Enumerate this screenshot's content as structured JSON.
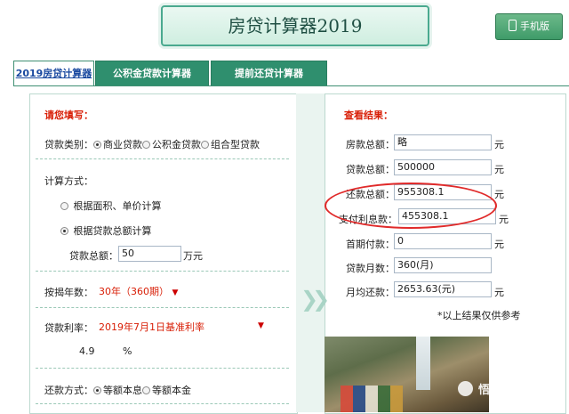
{
  "header": {
    "title": "房贷计算器2019",
    "mobile_button": "手机版"
  },
  "tabs": [
    {
      "label": "2019房贷计算器",
      "active": true
    },
    {
      "label": "公积金贷款计算器",
      "active": false
    },
    {
      "label": "提前还贷计算器",
      "active": false
    }
  ],
  "form": {
    "heading": "请您填写：",
    "loan_type": {
      "label": "贷款类别：",
      "options": [
        "商业贷款",
        "公积金贷款",
        "组合型贷款"
      ],
      "selected": "商业贷款"
    },
    "calc_method": {
      "label": "计算方式：",
      "options": [
        "根据面积、单价计算",
        "根据贷款总额计算"
      ],
      "selected": "根据贷款总额计算"
    },
    "loan_total": {
      "label": "贷款总额：",
      "value": "50",
      "unit": "万元"
    },
    "years": {
      "label": "按揭年数：",
      "value": "30年（360期）"
    },
    "rate": {
      "label": "贷款利率：",
      "value": "2019年7月1日基准利率",
      "number": "4.9",
      "unit": "%"
    },
    "repay": {
      "label": "还款方式：",
      "options": [
        "等额本息",
        "等额本金"
      ],
      "selected": "等额本息"
    }
  },
  "results": {
    "heading": "查看结果：",
    "rows": [
      {
        "label": "房款总额：",
        "value": "略",
        "unit": "元"
      },
      {
        "label": "贷款总额：",
        "value": "500000",
        "unit": "元"
      },
      {
        "label": "还款总额：",
        "value": "955308.1",
        "unit": "元"
      },
      {
        "label": "支付利息款：",
        "value": "455308.1",
        "unit": "元"
      },
      {
        "label": "首期付款：",
        "value": "0",
        "unit": "元"
      },
      {
        "label": "贷款月数：",
        "value": "360(月)",
        "unit": ""
      },
      {
        "label": "月均还款：",
        "value": "2653.63(元)",
        "unit": "元"
      }
    ],
    "note": "*以上结果仅供参考"
  },
  "watermark": "悟空问答",
  "colors": {
    "accent": "#2f8f6e",
    "highlight": "#e02a2a",
    "label_red": "#d81e06"
  }
}
